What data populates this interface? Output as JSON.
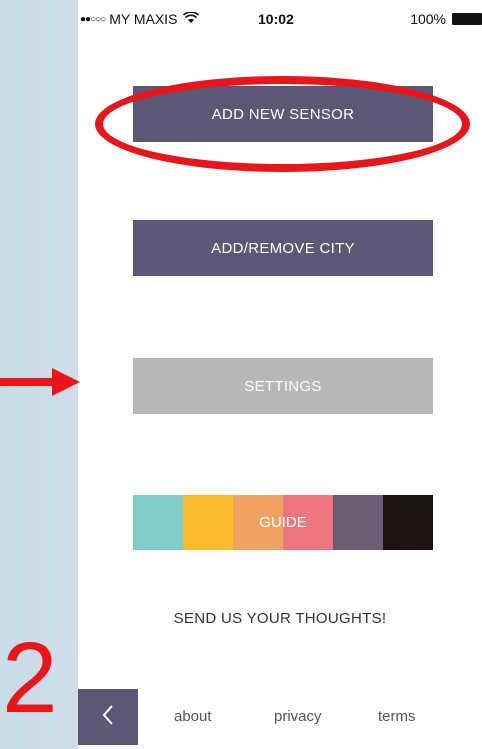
{
  "status_bar": {
    "signal": "●●○○○",
    "carrier": "MY MAXIS",
    "time": "10:02",
    "battery": "100%"
  },
  "menu": {
    "add_sensor": "ADD NEW SENSOR",
    "add_remove_city": "ADD/REMOVE CITY",
    "settings": "SETTINGS",
    "guide": "GUIDE",
    "guide_colors": [
      "#7ecdc8",
      "#fbbb2e",
      "#f0a265",
      "#ef7680",
      "#6e5b74",
      "#1c1412"
    ]
  },
  "feedback": "SEND US YOUR THOUGHTS!",
  "footer": {
    "about": "about",
    "privacy": "privacy",
    "terms": "terms"
  },
  "annotation": {
    "step_number": "2",
    "highlight_color": "#e8151b"
  }
}
